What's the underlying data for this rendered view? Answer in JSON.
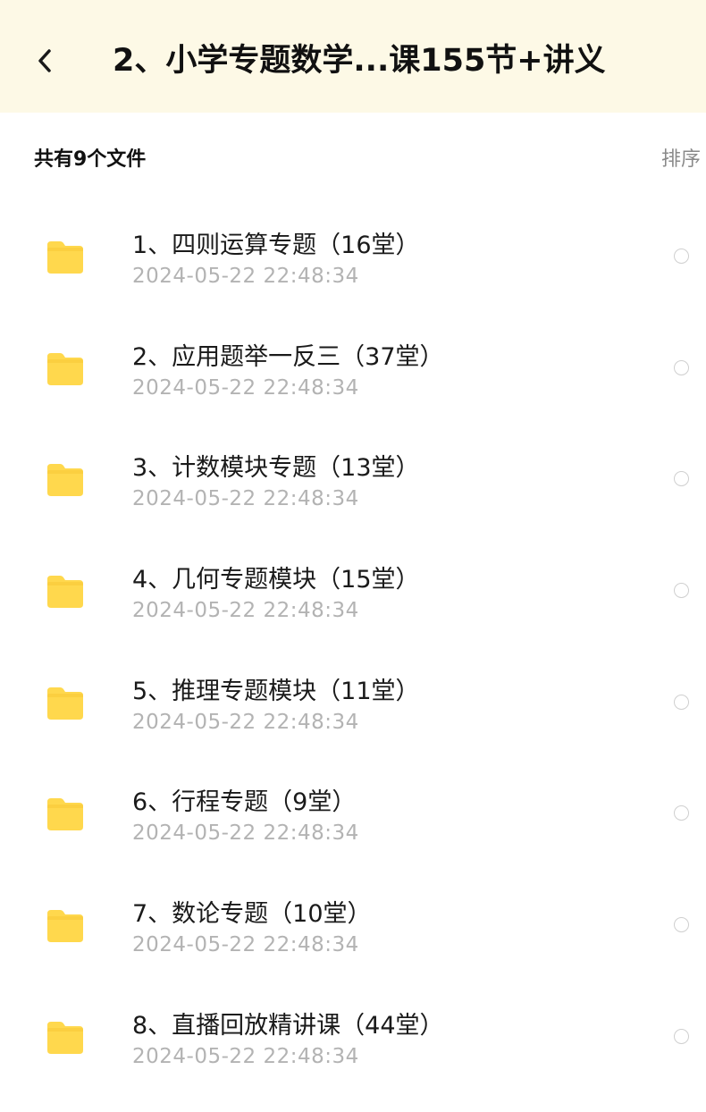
{
  "header": {
    "title": "2、小学专题数学...课155节+讲义",
    "back_icon": "chevron-left-icon"
  },
  "summary": {
    "file_count_label": "共有9个文件",
    "sort_label": "排序"
  },
  "colors": {
    "header_bg": "#fdf9e6",
    "folder": "#ffd84d",
    "date_text": "#b3b3b3"
  },
  "files": [
    {
      "name": "1、四则运算专题（16堂）",
      "date": "2024-05-22  22:48:34",
      "icon": "folder-icon"
    },
    {
      "name": "2、应用题举一反三（37堂）",
      "date": "2024-05-22  22:48:34",
      "icon": "folder-icon"
    },
    {
      "name": "3、计数模块专题（13堂）",
      "date": "2024-05-22  22:48:34",
      "icon": "folder-icon"
    },
    {
      "name": "4、几何专题模块（15堂）",
      "date": "2024-05-22  22:48:34",
      "icon": "folder-icon"
    },
    {
      "name": "5、推理专题模块（11堂）",
      "date": "2024-05-22  22:48:34",
      "icon": "folder-icon"
    },
    {
      "name": "6、行程专题（9堂）",
      "date": "2024-05-22  22:48:34",
      "icon": "folder-icon"
    },
    {
      "name": "7、数论专题（10堂）",
      "date": "2024-05-22  22:48:34",
      "icon": "folder-icon"
    },
    {
      "name": "8、直播回放精讲课（44堂）",
      "date": "2024-05-22  22:48:34",
      "icon": "folder-icon"
    }
  ]
}
